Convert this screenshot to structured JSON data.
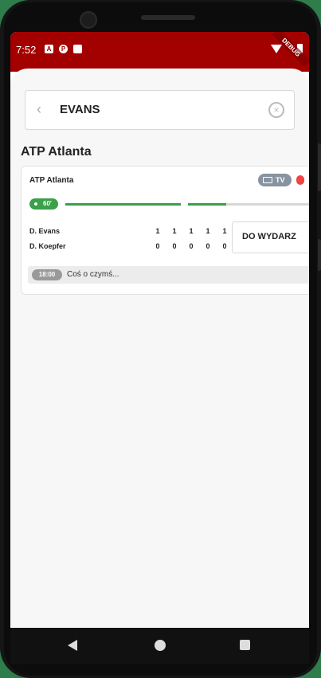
{
  "status": {
    "time": "7:52",
    "debug": "DEBUG",
    "icons": [
      "a-icon",
      "p-icon",
      "sd-card-icon"
    ]
  },
  "search": {
    "value": "EVANS"
  },
  "section": {
    "title": "ATP Atlanta"
  },
  "match": {
    "tournament": "ATP Atlanta",
    "tv_label": "TV",
    "live_label": "60'",
    "progress": [
      1.0,
      0.29
    ],
    "players": [
      {
        "name": "D. Evans",
        "scores": [
          "1",
          "1",
          "1",
          "1",
          "1"
        ]
      },
      {
        "name": "D. Koepfer",
        "scores": [
          "0",
          "0",
          "0",
          "0",
          "0"
        ]
      }
    ],
    "event_button": "DO WYDARZ",
    "note_time": "18:00",
    "note_text": "Coś o czymś..."
  },
  "colors": {
    "accent": "#a30000",
    "live": "#3aa04a"
  }
}
